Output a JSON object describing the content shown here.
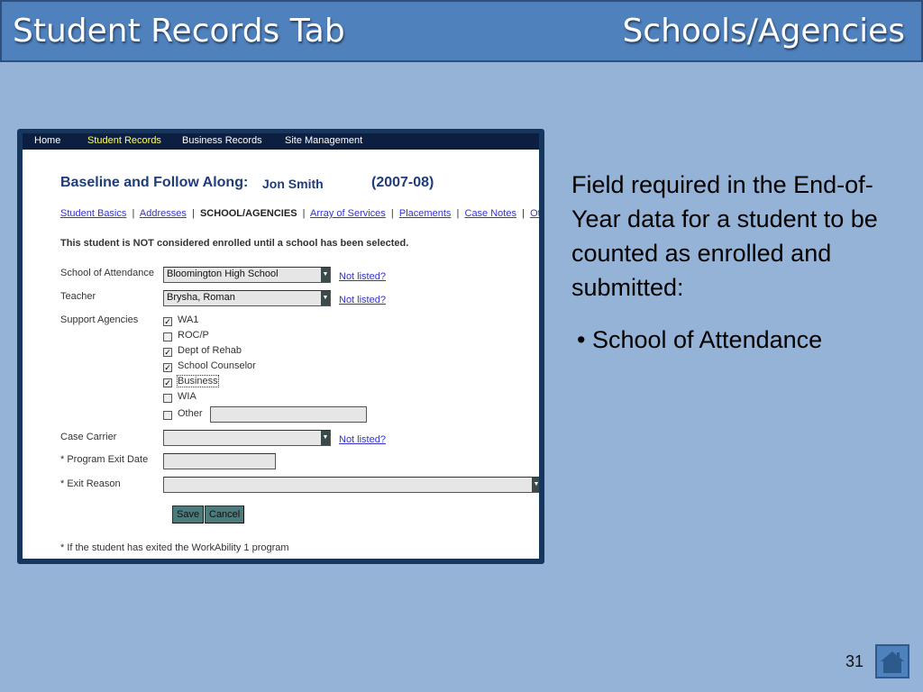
{
  "slide": {
    "title": "Student Records Tab",
    "subtitle": "Schools/Agencies",
    "page_number": "31"
  },
  "nav": [
    "Home",
    "Student Records",
    "Business Records",
    "Site Management"
  ],
  "page": {
    "heading": "Baseline and Follow Along:",
    "student": "Jon Smith",
    "year": "(2007-08)",
    "tabs": [
      "Student Basics",
      "Addresses",
      "SCHOOL/AGENCIES",
      "Array of Services",
      "Placements",
      "Case Notes",
      "Other"
    ],
    "separator": "|",
    "notice": "This student is NOT considered enrolled until a school has been selected.",
    "school_label": "School of Attendance",
    "school_value": "Bloomington High School",
    "teacher_label": "Teacher",
    "teacher_value": "Brysha, Roman",
    "not_listed": "Not listed?",
    "agencies_label": "Support Agencies",
    "agencies": [
      {
        "label": "WA1",
        "checked": true
      },
      {
        "label": "ROC/P",
        "checked": false
      },
      {
        "label": "Dept of Rehab",
        "checked": true
      },
      {
        "label": "School Counselor",
        "checked": true
      },
      {
        "label": "Business",
        "checked": true
      },
      {
        "label": "WIA",
        "checked": false
      },
      {
        "label": "Other",
        "checked": false
      }
    ],
    "case_carrier_label": "Case Carrier",
    "case_carrier_value": "",
    "exit_date_label": "* Program Exit Date",
    "exit_date_value": "",
    "exit_reason_label": "* Exit Reason",
    "exit_reason_value": "",
    "save": "Save",
    "cancel": "Cancel",
    "footnote": "* If the student has exited the WorkAbility 1 program"
  },
  "side": {
    "text": "Field required in the End-of-Year data for a student to be counted as enrolled and submitted:",
    "bullet": "• School of Attendance"
  },
  "colors": {
    "header": "#4f81bd",
    "background": "#95b3d7",
    "nav": "#0d1f40",
    "active_nav": "#ffff66"
  }
}
